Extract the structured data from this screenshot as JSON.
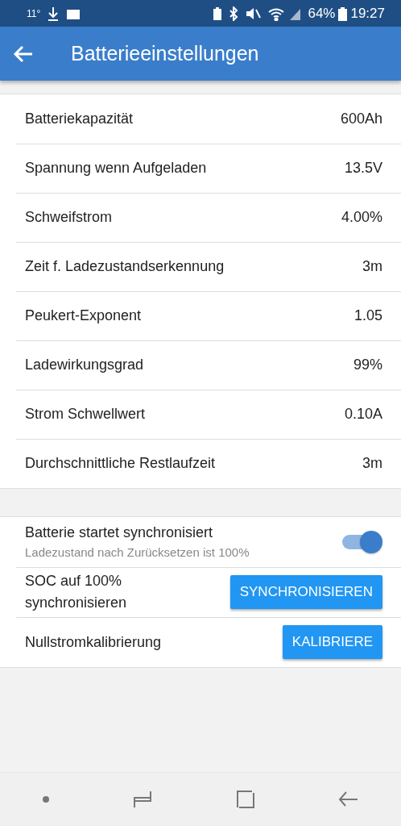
{
  "status_bar": {
    "temperature": "11°",
    "battery_percent": "64%",
    "time": "19:27"
  },
  "app_bar": {
    "title": "Batterieeinstellungen"
  },
  "settings": [
    {
      "label": "Batteriekapazität",
      "value": "600Ah"
    },
    {
      "label": "Spannung wenn Aufgeladen",
      "value": "13.5V"
    },
    {
      "label": "Schweifstrom",
      "value": "4.00%"
    },
    {
      "label": "Zeit f. Ladezustandserkennung",
      "value": "3m"
    },
    {
      "label": "Peukert-Exponent",
      "value": "1.05"
    },
    {
      "label": "Ladewirkungsgrad",
      "value": "99%"
    },
    {
      "label": "Strom Schwellwert",
      "value": "0.10A"
    },
    {
      "label": "Durchschnittliche Restlaufzeit",
      "value": "3m"
    }
  ],
  "actions": [
    {
      "kind": "toggle",
      "label": "Batterie startet synchronisiert",
      "description": "Ladezustand nach Zurücksetzen ist 100%",
      "on": true
    },
    {
      "kind": "button",
      "label": "SOC auf 100% synchronisieren",
      "button": "SYNCHRONISIEREN"
    },
    {
      "kind": "button",
      "label": "Nullstromkalibrierung",
      "button": "KALIBRIERE"
    }
  ]
}
